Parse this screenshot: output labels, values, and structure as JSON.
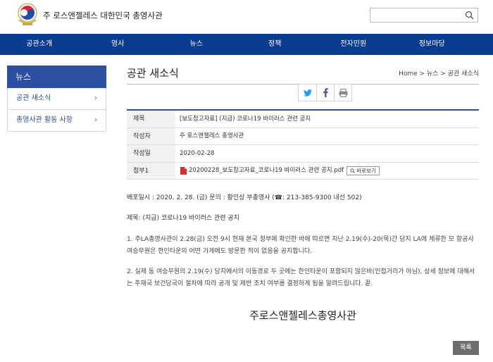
{
  "header": {
    "site_title": "주 로스앤젤레스 대한민국 총영사관",
    "search_placeholder": ""
  },
  "nav": {
    "items": [
      "공관소개",
      "영사",
      "뉴스",
      "정책",
      "전자민원",
      "정보마당"
    ]
  },
  "sidebar": {
    "heading": "뉴스",
    "items": [
      {
        "label": "공관 새소식"
      },
      {
        "label": "총영사관 활동 사항"
      }
    ]
  },
  "main": {
    "page_title": "공관 새소식",
    "breadcrumb": "Home > 뉴스 > 공관 새소식"
  },
  "share": {
    "icons": [
      "twitter-icon",
      "facebook-icon",
      "print-icon"
    ],
    "colors": {
      "twitter": "#1da1f2",
      "facebook": "#3b5998"
    }
  },
  "post": {
    "subject_label": "제목",
    "subject": "[보도참고자료] (지급) 코로나19 바이러스 관련 공지",
    "author_label": "작성자",
    "author": "주 로스앤젤레스 총영사관",
    "date_label": "작성일",
    "date": "2020-02-28",
    "attachment_label": "첨부1",
    "attachment_name": "20200228_보도참고자료_코로나19 바이러스 관련 공지.pdf",
    "preview_label": "바로보기"
  },
  "content": {
    "release_line": "배포일시 : 2020. 2. 28. (금) 문의 : 황인상 부총영사 (☎: 213-385-9300 내선 502)",
    "subject_line": "제목: (지급) 코로나19 바이러스 관련 공지",
    "para1": "1. 주LA총영사관이 2.28(금) 오전 9시 현재 본국 정부에 확인한 바에 따르면 지난 2.19(수)-20(목)간 당지 LA에 체류한 모 항공사 여승무원은 한인타운의 어떤 가게에도 방문한 적이 없음을 공지합니다.",
    "para2": "2. 실제 동 여승무원의 2.19(수) 당지에서의 이동경로 두 곳에는 한인타운이 포함되지 않은바(인접거리가 아님), 상세 정보에 대해서는 주재국 보건당국이 절차에 따라 공개 및 제반 조치 여부를 결정하게 됨을 알려드립니다.   끝.",
    "closing": "주로스앤젤레스총영사관"
  },
  "footer": {
    "list_button": "목록"
  },
  "colors": {
    "nav_bg": "#0a3d8f",
    "sidebar_head_bg": "#2c4fa3",
    "accent": "#2c4fa3"
  }
}
